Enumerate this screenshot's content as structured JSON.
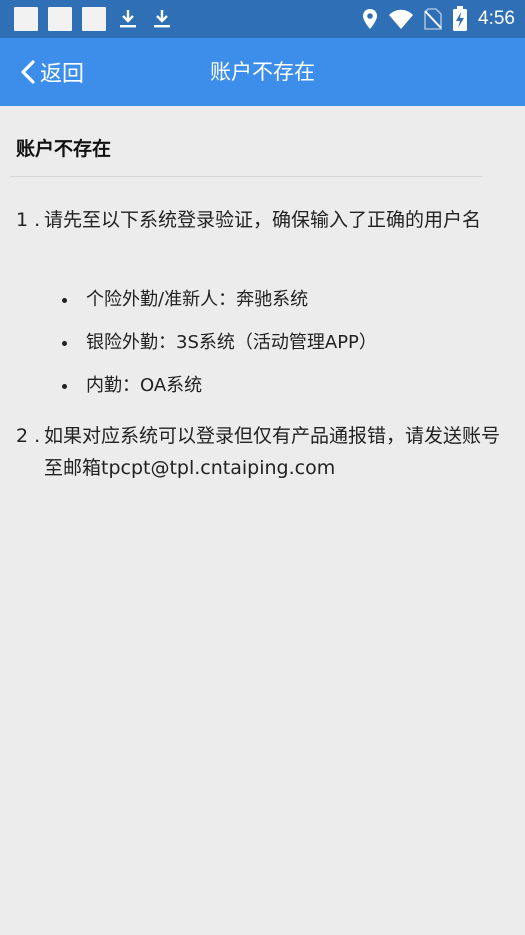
{
  "status_bar": {
    "time": "4:56",
    "icons": [
      "notification-square-icon",
      "notification-square-icon",
      "notification-square-icon",
      "download-icon",
      "download-icon",
      "location-icon",
      "wifi-icon",
      "no-sim-icon",
      "battery-charging-icon"
    ]
  },
  "top_bar": {
    "back_label": "返回",
    "title": "账户不存在"
  },
  "content": {
    "heading": "账户不存在",
    "step1": {
      "num": "1 .",
      "text": "请先至以下系统登录验证，确保输入了正确的用户名"
    },
    "bullets": [
      "个险外勤/准新人：奔驰系统",
      "银险外勤：3S系统（活动管理APP）",
      "内勤：OA系统"
    ],
    "step2": {
      "num": "2 .",
      "text": "如果对应系统可以登录但仅有产品通报错，请发送账号至邮箱tpcpt@tpl.cntaiping.com"
    }
  },
  "colors": {
    "status_bar": "#2f6fb5",
    "top_bar": "#3d8eea",
    "background": "#ececec"
  }
}
